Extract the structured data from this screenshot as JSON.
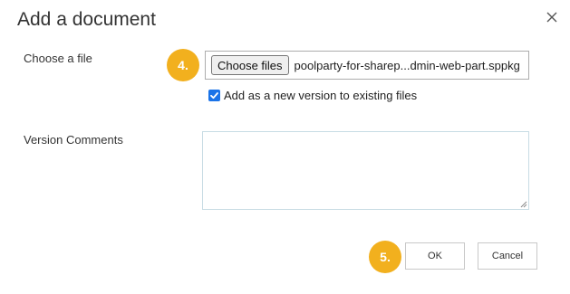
{
  "dialog": {
    "title": "Add a document",
    "close_icon": "close-icon"
  },
  "file_row": {
    "label": "Choose a file",
    "step_badge": "4.",
    "choose_button_label": "Choose files",
    "file_name": "poolparty-for-sharep...dmin-web-part.sppkg"
  },
  "version_option": {
    "checked": true,
    "label": "Add as a new version to existing files"
  },
  "comments": {
    "label": "Version Comments",
    "value": ""
  },
  "actions": {
    "step_badge": "5.",
    "ok_label": "OK",
    "cancel_label": "Cancel"
  },
  "colors": {
    "badge": "#f2b01e",
    "checkbox": "#1a73e8",
    "comments_border": "#c8dce4"
  }
}
